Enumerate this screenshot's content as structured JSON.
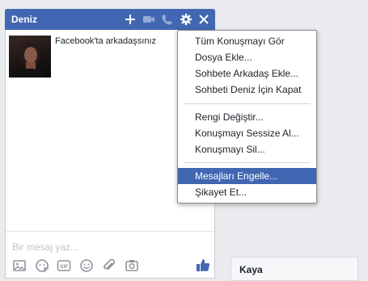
{
  "chat": {
    "title": "Deniz",
    "friend_text": "Facebook'ta arkadaşsınız",
    "composer_placeholder": "Bir mesaj yaz...",
    "header_icons": [
      "plus-icon",
      "video-icon",
      "phone-icon",
      "gear-icon",
      "close-icon"
    ],
    "toolbar_icons": [
      "photo-icon",
      "sticker-icon",
      "gif-icon",
      "emoji-icon",
      "attachment-icon",
      "camera-icon"
    ],
    "accent": "#4267b2"
  },
  "menu": {
    "items": [
      "Tüm Konuşmayı Gör",
      "Dosya Ekle...",
      "Sohbete Arkadaş Ekle...",
      "Sohbeti Deniz İçin Kapat",
      "Rengi Değiştir...",
      "Konuşmayı Sessize Al...",
      "Konuşmayı Sil...",
      "Mesajları Engelle...",
      "Şikayet Et..."
    ],
    "highlighted": "Mesajları Engelle..."
  },
  "second_chat": {
    "title": "Kaya"
  }
}
